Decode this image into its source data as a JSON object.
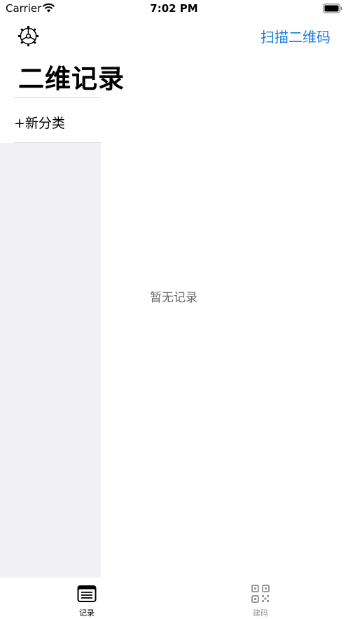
{
  "status_bar": {
    "carrier": "Carrier",
    "time": "7:02 PM"
  },
  "nav": {
    "settings_icon": "gear-icon",
    "scan_label": "扫描二维码"
  },
  "page": {
    "title": "二维记录"
  },
  "sidebar": {
    "add_category_label": "+新分类"
  },
  "main": {
    "empty_text": "暂无记录"
  },
  "tabbar": {
    "tabs": [
      {
        "label": "记录",
        "icon": "list-icon",
        "selected": true
      },
      {
        "label": "建码",
        "icon": "qr-code-icon",
        "selected": false
      }
    ]
  },
  "colors": {
    "accent": "#1a7fe0",
    "sidebar_bg": "#f1f0f5",
    "inactive_tab": "#9a9a9a"
  }
}
